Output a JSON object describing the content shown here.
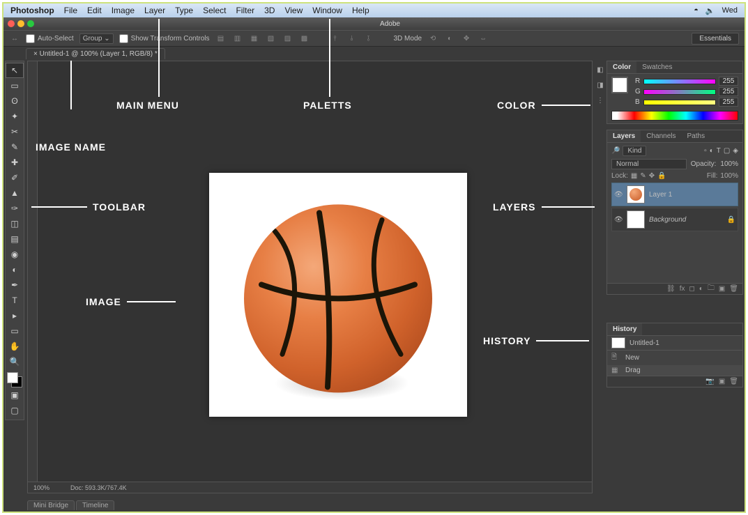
{
  "macbar": {
    "app": "Photoshop",
    "menus": [
      "File",
      "Edit",
      "Image",
      "Layer",
      "Type",
      "Select",
      "Filter",
      "3D",
      "View",
      "Window",
      "Help"
    ],
    "clock": "Wed"
  },
  "titlebar": {
    "title": "Adobe"
  },
  "options": {
    "auto_select": "Auto-Select",
    "group": "Group",
    "show_transform": "Show Transform Controls",
    "mode3d": "3D Mode",
    "workspace": "Essentials"
  },
  "doc_tab": "Untitled-1 @ 100% (Layer 1, RGB/8) *",
  "status": {
    "zoom": "100%",
    "doc": "Doc: 593.3K/767.4K"
  },
  "bottom_tabs": [
    "Mini Bridge",
    "Timeline"
  ],
  "panels": {
    "color": {
      "tabs": [
        "Color",
        "Swatches"
      ],
      "channels": [
        {
          "label": "R",
          "value": "255"
        },
        {
          "label": "G",
          "value": "255"
        },
        {
          "label": "B",
          "value": "255"
        }
      ]
    },
    "layers": {
      "tabs": [
        "Layers",
        "Channels",
        "Paths"
      ],
      "kind": "Kind",
      "blend": "Normal",
      "opacity_label": "Opacity:",
      "opacity": "100%",
      "lock_label": "Lock:",
      "fill_label": "Fill:",
      "fill": "100%",
      "items": [
        {
          "name": "Layer 1"
        },
        {
          "name": "Background"
        }
      ]
    },
    "history": {
      "title": "History",
      "doc": "Untitled-1",
      "steps": [
        "New",
        "Drag"
      ]
    }
  },
  "annotations": {
    "main_menu": "MAIN MENU",
    "paletts": "PALETTS",
    "color": "COLOR",
    "image_name": "IMAGE NAME",
    "toolbar": "TOOLBAR",
    "layers": "LAYERS",
    "image": "IMAGE",
    "history": "HISTORY"
  }
}
